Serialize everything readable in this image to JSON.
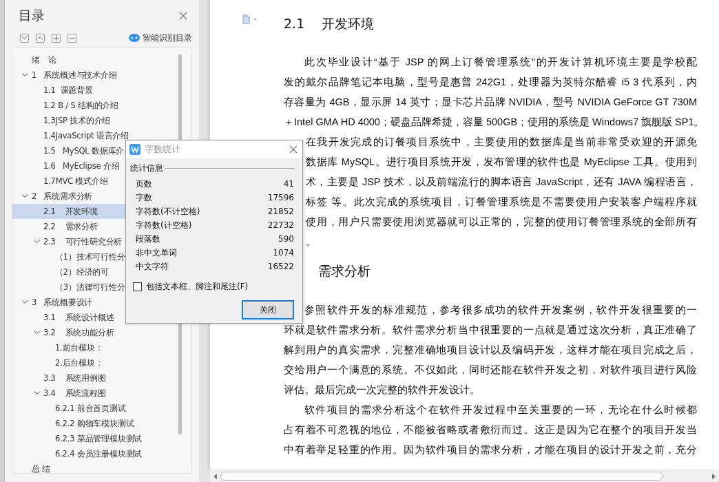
{
  "toc_panel": {
    "title": "目录",
    "smart_button": "智能识别目录",
    "items": [
      {
        "label": "绪　论",
        "selected": false
      },
      {
        "label": "1   系统概述与技术介绍",
        "selected": false,
        "expanded": true,
        "children": [
          {
            "label": "1.1  课题背景",
            "selected": false
          },
          {
            "label": "1.2 B / S 结构的介绍",
            "selected": false
          },
          {
            "label": "1.3JSP 技术的介绍",
            "selected": false
          },
          {
            "label": "1.4JavaScript 语言介绍",
            "selected": false
          },
          {
            "label": "1.5   MySQL 数据库介",
            "selected": false
          },
          {
            "label": "1.6   MyEclipse 介绍",
            "selected": false
          },
          {
            "label": "1.7MVC 模式介绍",
            "selected": false
          }
        ]
      },
      {
        "label": "2   系统需求分析",
        "selected": false,
        "expanded": true,
        "children": [
          {
            "label": "2.1    开发环境",
            "selected": true
          },
          {
            "label": "2.2    需求分析",
            "selected": false
          },
          {
            "label": "2.3    可行性研究分析",
            "selected": false,
            "expanded": true,
            "children": [
              {
                "label": "（1）技术可行性分",
                "selected": false
              },
              {
                "label": "（2）经济的可",
                "selected": false
              },
              {
                "label": "（3）法律可行性分",
                "selected": false
              }
            ]
          }
        ]
      },
      {
        "label": "3   系统概要设计",
        "selected": false,
        "expanded": true,
        "children": [
          {
            "label": "3.1    系统设计概述",
            "selected": false
          },
          {
            "label": "3.2    系统功能分析",
            "selected": false,
            "expanded": true,
            "children": [
              {
                "label": "1.前台模块：",
                "selected": false
              },
              {
                "label": "2.后台模块：",
                "selected": false
              }
            ]
          },
          {
            "label": "3.3    系统用例图",
            "selected": false
          },
          {
            "label": "3.4    系统流程图",
            "selected": false,
            "expanded": true,
            "children": [
              {
                "label": "6.2.1 前台首页测试",
                "selected": false
              },
              {
                "label": "6.2.2 购物车模块测试",
                "selected": false
              },
              {
                "label": "6.2.3 菜品管理模块测试",
                "selected": false
              },
              {
                "label": "6.2.4 会员注册模块测试",
                "selected": false
              }
            ]
          }
        ]
      },
      {
        "label": "总 结",
        "selected": false
      }
    ]
  },
  "document": {
    "blocks": [
      {
        "kind": "heading",
        "text": "2.1　 开发环境"
      },
      {
        "kind": "paragraph",
        "lines": [
          {
            "text": "此次毕业设计“基于 JSP 的网上订餐管理系统”的开发计算机环境主要是学校配",
            "kind": "first"
          },
          {
            "text": "发的戴尔品牌笔记本电脑，型号是惠普 242G1，处理器为英特尔酷睿 i5 3 代系列，内",
            "kind": "body"
          },
          {
            "text": "存容量为  4GB，显示屏  14 英寸；显卡芯片品牌 NVIDIA，型号 NVIDIA GeForce GT 730M",
            "kind": "body"
          },
          {
            "text": "＋Intel GMA HD 4000；硬盘品牌希捷，容量 500GB；使用的系统是 Windows7 旗舰版  SP1。",
            "kind": "body"
          }
        ]
      },
      {
        "kind": "paragraph",
        "lines": [
          {
            "text": "在我开发完成的订餐项目系统中，主要使用的数据库是当前非常受欢迎的开源免",
            "kind": "partial"
          },
          {
            "text": "数据库 MySQL。进行项目系统开发，发布管理的软件也是 MyEclipse 工具。使用到",
            "kind": "partial"
          },
          {
            "text": "术，主要是 JSP 技术，以及前端流行的脚本语言 JavaScript，还有 JAVA 编程语言，",
            "kind": "partial"
          },
          {
            "text": "标签  等。此次完成的系统项目，订餐管理系统是不需要使用户安装客户端程序就",
            "kind": "partial"
          },
          {
            "text": "使用，用户只需要使用浏览器就可以正常的，完整的使用订餐管理系统的全部所有",
            "kind": "partial"
          },
          {
            "text": "。",
            "kind": "partial_end"
          }
        ]
      },
      {
        "kind": "partial_heading",
        "text": "需求分析"
      },
      {
        "kind": "paragraph",
        "lines": [
          {
            "text": "参照软件开发的标准规范，参考很多成功的软件开发案例，软件开发很重要的一",
            "kind": "first"
          },
          {
            "text": "环就是软件需求分析。软件需求分析当中很重要的一点就是通过这次分析，真正准确了",
            "kind": "body"
          },
          {
            "text": "解到用户的真实需求，完整准确地项目设计以及编码开发，这样才能在项目完成之后，",
            "kind": "body"
          },
          {
            "text": "交给用户一个满意的系统。不仅如此，同时还能在软件开发之初，对软件项目进行风险",
            "kind": "body"
          },
          {
            "text": "评估。最后完成一次完整的软件开发设计。",
            "kind": "end"
          }
        ]
      },
      {
        "kind": "paragraph",
        "lines": [
          {
            "text": "软件项目的需求分析这个在软件开发过程中至关重要的一环，无论在什么时候都",
            "kind": "first"
          },
          {
            "text": "占有着不可忽视的地位，不能被省略或者敷衍而过。这正是因为它在整个的项目开发当",
            "kind": "body"
          },
          {
            "text": "中有着举足轻重的作用。因为软件项目的需求分析，才能在项目的设计开发之前，充分",
            "kind": "body"
          }
        ]
      }
    ]
  },
  "dialog": {
    "title": "字数统计",
    "group": "统计信息",
    "rows": [
      {
        "label": "页数",
        "value": "41"
      },
      {
        "label": "字数",
        "value": "17596"
      },
      {
        "label": "字符数(不计空格)",
        "value": "21852"
      },
      {
        "label": "字符数(计空格)",
        "value": "22732"
      },
      {
        "label": "段落数",
        "value": "590"
      },
      {
        "label": "非中文单词",
        "value": "1074"
      },
      {
        "label": "中文字符",
        "value": "16522"
      }
    ],
    "checkbox": {
      "label": "包括文本框、脚注和尾注(F)",
      "checked": false
    },
    "button": "关闭"
  }
}
